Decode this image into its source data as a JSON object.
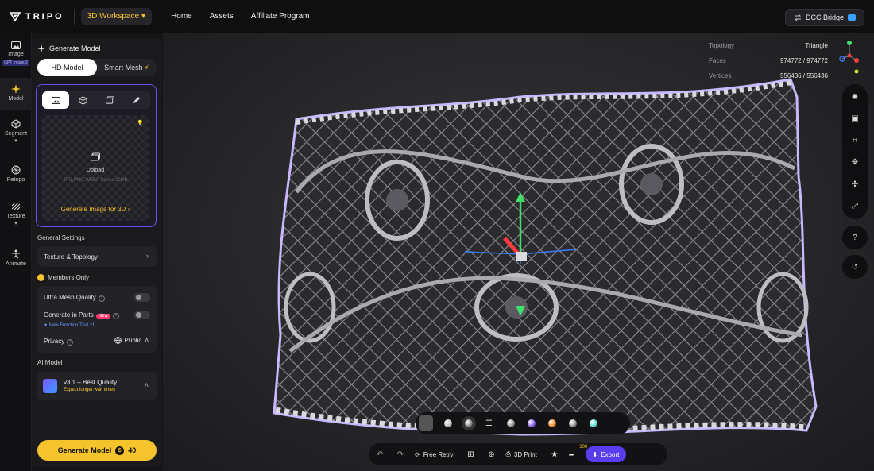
{
  "app": {
    "brand": "TRIPO"
  },
  "topbar": {
    "workspace": "3D Workspace",
    "nav": [
      "Home",
      "Assets",
      "Affiliate Program"
    ],
    "dcc_bridge": "DCC Bridge"
  },
  "rail": {
    "items": [
      {
        "label": "Image",
        "badge": "GPT Image 2",
        "icon": "image-icon"
      },
      {
        "label": "Model",
        "icon": "sparkle-icon",
        "active": true
      },
      {
        "label": "Segment",
        "icon": "cube-icon",
        "caret": true
      },
      {
        "label": "Retopo",
        "icon": "mesh-icon"
      },
      {
        "label": "Texture",
        "icon": "texture-icon",
        "caret": true
      },
      {
        "label": "Animate",
        "icon": "figure-icon"
      }
    ]
  },
  "panel": {
    "title": "Generate Model",
    "tabs": {
      "hd": "HD Model",
      "smart": "Smart Mesh"
    },
    "upload": {
      "label": "Upload",
      "hint": "JPG,PNG,WEBP Size ≤ 20MB",
      "generate_link": "Generate Image for 3D"
    },
    "general_settings": "General Settings",
    "texture_topology": "Texture & Topology",
    "members_only": "Members Only",
    "ultra_mesh": "Ultra Mesh Quality",
    "generate_parts": "Generate in Parts",
    "new_badge": "New",
    "trial": "New Function Trial x1",
    "privacy": {
      "label": "Privacy",
      "value": "Public"
    },
    "ai_model": {
      "heading": "AI Model",
      "name": "v3.1 – Best Quality",
      "sub": "Expect longer wait times"
    },
    "generate_button": {
      "label": "Generate Model",
      "cost": "40"
    }
  },
  "viewport": {
    "stats": [
      {
        "key": "Topology",
        "value": "Triangle"
      },
      {
        "key": "Faces",
        "value": "974772 / 974772"
      },
      {
        "key": "Vertices",
        "value": "556436 / 556436"
      }
    ]
  },
  "bottombar": {
    "free_retry": "Free Retry",
    "print": "3D Print",
    "share_bonus": "+300",
    "export": "Export"
  },
  "materials": [
    "#bdbdbd",
    "#8a8a8a",
    "#8f6bff",
    "#f28c28",
    "#9a9a9a",
    "#5fe0d0"
  ],
  "colors": {
    "accent": "#f5c42c",
    "purple": "#5b3df0"
  }
}
